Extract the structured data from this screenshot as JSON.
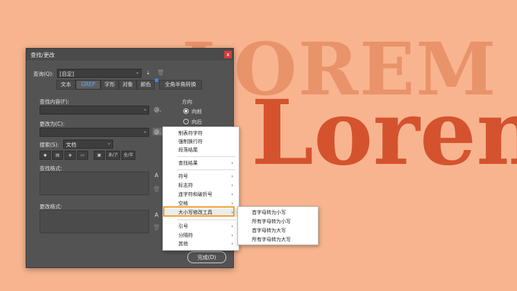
{
  "background": {
    "word_top": "LOREM",
    "word_bottom": "Loren",
    "color": "#F7B48F"
  },
  "dialog": {
    "title": "查找/更改",
    "close_label": "x",
    "query_label": "查询(Q):",
    "query_value": "[自定]",
    "tabs": [
      "文本",
      "GREP",
      "字形",
      "对象",
      "颜色",
      "全角半角转换"
    ],
    "active_tab": "GREP",
    "find_label": "查找内容(F):",
    "find_value": "",
    "change_label": "更改为(C):",
    "change_value": "",
    "direction_label": "方向",
    "direction_forward": "向前",
    "direction_backward": "向后",
    "search_label": "搜索(S):",
    "search_value": "文档",
    "find_format_label": "查找格式:",
    "change_format_label": "更改格式:",
    "btn_kana": "あ/ア",
    "btn_width": "全/半",
    "done_label": "完成(D)"
  },
  "menu": {
    "items": [
      {
        "label": "制表符字符",
        "submenu": false
      },
      {
        "label": "强制换行符",
        "submenu": false
      },
      {
        "label": "段落结尾",
        "submenu": false
      },
      {
        "label": "查找结果",
        "submenu": true
      },
      {
        "label": "符号",
        "submenu": true
      },
      {
        "label": "标志符",
        "submenu": true
      },
      {
        "label": "连字符和破折号",
        "submenu": true
      },
      {
        "label": "空格",
        "submenu": true
      },
      {
        "label": "大小写修改工具",
        "submenu": true
      },
      {
        "label": "引号",
        "submenu": true
      },
      {
        "label": "分隔符",
        "submenu": true
      },
      {
        "label": "其他",
        "submenu": true
      }
    ],
    "highlight_color": "#F0A030"
  },
  "submenu": {
    "items": [
      "首字母转为小写",
      "所有字母转为小写",
      "首字母转为大写",
      "所有字母转为大写"
    ]
  }
}
